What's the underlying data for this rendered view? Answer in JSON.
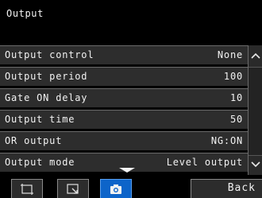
{
  "header": {
    "title": "Output"
  },
  "rows": [
    {
      "label": "Output control",
      "value": "None"
    },
    {
      "label": "Output period",
      "value": "100"
    },
    {
      "label": "Gate ON delay",
      "value": "10"
    },
    {
      "label": "Output time",
      "value": "50"
    },
    {
      "label": "OR output",
      "value": "NG:ON"
    },
    {
      "label": "Output mode",
      "value": "Level output"
    }
  ],
  "scrollbar": {
    "up_icon": "chevron-up-icon",
    "down_icon": "chevron-down-icon"
  },
  "toolbar": {
    "buttons": [
      {
        "icon": "frame-icon",
        "active": false
      },
      {
        "icon": "zoom-view-icon",
        "active": false
      },
      {
        "icon": "camera-icon",
        "active": true
      }
    ],
    "back_label": "Back"
  },
  "colors": {
    "accent": "#0d64c9",
    "row_bg": "#2d2d2d",
    "background": "#000000"
  }
}
